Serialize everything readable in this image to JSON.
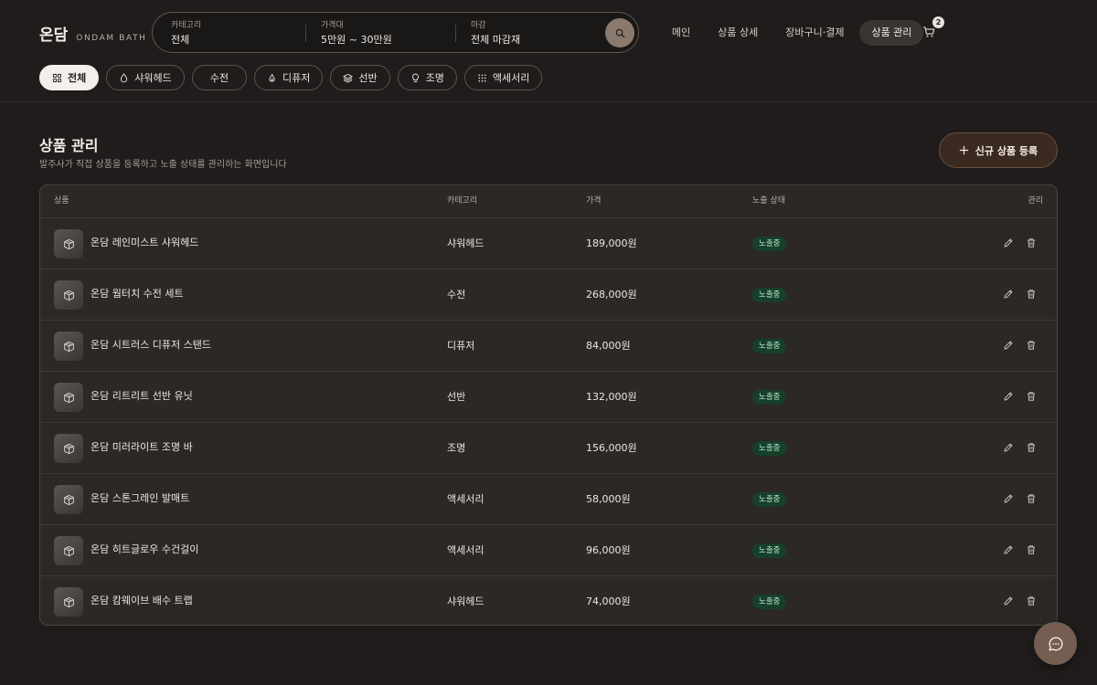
{
  "brand": {
    "name_ko": "온담",
    "name_en": "ONDAM BATH"
  },
  "search": {
    "category": {
      "label": "카테고리",
      "value": "전체"
    },
    "price": {
      "label": "가격대",
      "value": "5만원 ~ 30만원"
    },
    "finish": {
      "label": "마감",
      "value": "전체 마감재"
    },
    "button_icon": "search-icon"
  },
  "nav": {
    "items": [
      {
        "label": "메인"
      },
      {
        "label": "상품 상세"
      },
      {
        "label": "장바구니·결제"
      },
      {
        "label": "상품 관리",
        "active": true
      }
    ],
    "cart_count": "2"
  },
  "filters": [
    {
      "label": "전체",
      "icon": "grid-icon",
      "active": true
    },
    {
      "label": "샤워헤드",
      "icon": "droplet-icon"
    },
    {
      "label": "수전",
      "icon": ""
    },
    {
      "label": "디퓨저",
      "icon": "flame-icon"
    },
    {
      "label": "선반",
      "icon": "layers-icon"
    },
    {
      "label": "조명",
      "icon": "lightbulb-icon"
    },
    {
      "label": "액세서리",
      "icon": "dots-grid-icon"
    }
  ],
  "page": {
    "title": "상품 관리",
    "subtitle": "발주사가 직접 상품을 등록하고 노출 상태를 관리하는 화면입니다",
    "add_button": "신규 상품 등록"
  },
  "table": {
    "headers": {
      "product": "상품",
      "category": "카테고리",
      "price": "가격",
      "status": "노출 상태",
      "manage": "관리"
    },
    "rows": [
      {
        "name": "온담 레인미스트 샤워헤드",
        "category": "샤워헤드",
        "price": "189,000원",
        "status": "노출중"
      },
      {
        "name": "온담 웜터치 수전 세트",
        "category": "수전",
        "price": "268,000원",
        "status": "노출중"
      },
      {
        "name": "온담 시트러스 디퓨저 스탠드",
        "category": "디퓨저",
        "price": "84,000원",
        "status": "노출중"
      },
      {
        "name": "온담 리트리트 선반 유닛",
        "category": "선반",
        "price": "132,000원",
        "status": "노출중"
      },
      {
        "name": "온담 미러라이트 조명 바",
        "category": "조명",
        "price": "156,000원",
        "status": "노출중"
      },
      {
        "name": "온담 스톤그레인 발매트",
        "category": "액세서리",
        "price": "58,000원",
        "status": "노출중"
      },
      {
        "name": "온담 히트글로우 수건걸이",
        "category": "액세서리",
        "price": "96,000원",
        "status": "노출중"
      },
      {
        "name": "온담 캄웨이브 배수 트랩",
        "category": "샤워헤드",
        "price": "74,000원",
        "status": "노출중"
      }
    ]
  },
  "colors": {
    "background": "#1f1c1b",
    "accent": "#735e51",
    "badge": "#17402c"
  }
}
